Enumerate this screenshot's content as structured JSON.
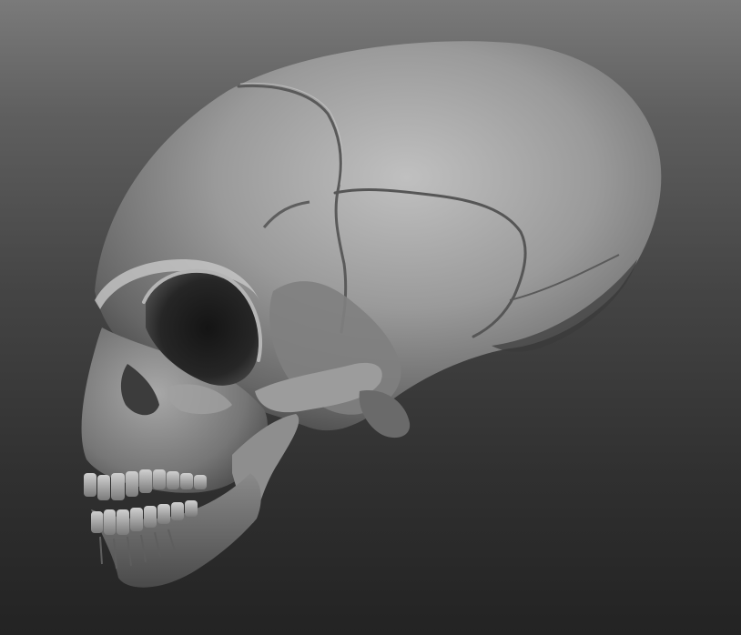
{
  "scene": {
    "subject_icon": "elongated-skull-sculpt",
    "render_style": "matcap-gray",
    "colors": {
      "background_top": "#7a7a7a",
      "background_bottom": "#232323",
      "material_highlight": "#c2c2c2",
      "material_mid": "#7c7c7c",
      "material_shadow": "#262626"
    }
  }
}
